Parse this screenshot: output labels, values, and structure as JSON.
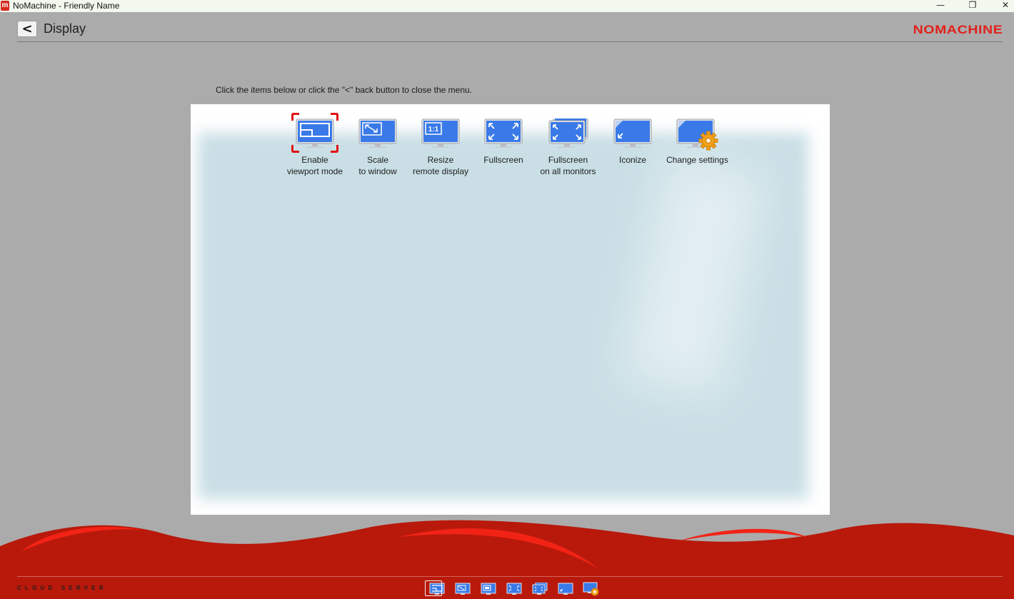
{
  "window": {
    "app_icon_letter": "m",
    "title": "NoMachine - Friendly Name",
    "minimize": "—",
    "restore": "❐",
    "close": "✕"
  },
  "header": {
    "back_label": "<",
    "title": "Display",
    "logo": "NOMACHINE"
  },
  "hint": "Click the items below or click the \"<\" back button to close the menu.",
  "menu": {
    "items": [
      {
        "line1": "Enable",
        "line2": "viewport mode",
        "icon": "viewport-icon",
        "selected": true
      },
      {
        "line1": "Scale",
        "line2": "to window",
        "icon": "scale-icon",
        "selected": false
      },
      {
        "line1": "Resize",
        "line2": "remote display",
        "icon": "resize-icon",
        "selected": false
      },
      {
        "line1": "Fullscreen",
        "line2": "",
        "icon": "fullscreen-icon",
        "selected": false
      },
      {
        "line1": "Fullscreen",
        "line2": "on all monitors",
        "icon": "fullscreen-all-icon",
        "selected": false
      },
      {
        "line1": "Iconize",
        "line2": "",
        "icon": "iconize-icon",
        "selected": false
      },
      {
        "line1": "Change settings",
        "line2": "",
        "icon": "settings-icon",
        "selected": false
      }
    ],
    "resize_badge": "1:1"
  },
  "footer": {
    "product": "CLOUD SERVER"
  },
  "colors": {
    "selection": "#e01010",
    "monitor_blue": "#3a7ae8",
    "brand_red": "#e2211c",
    "wave_red": "#b61a0c",
    "background": "#ababab"
  }
}
